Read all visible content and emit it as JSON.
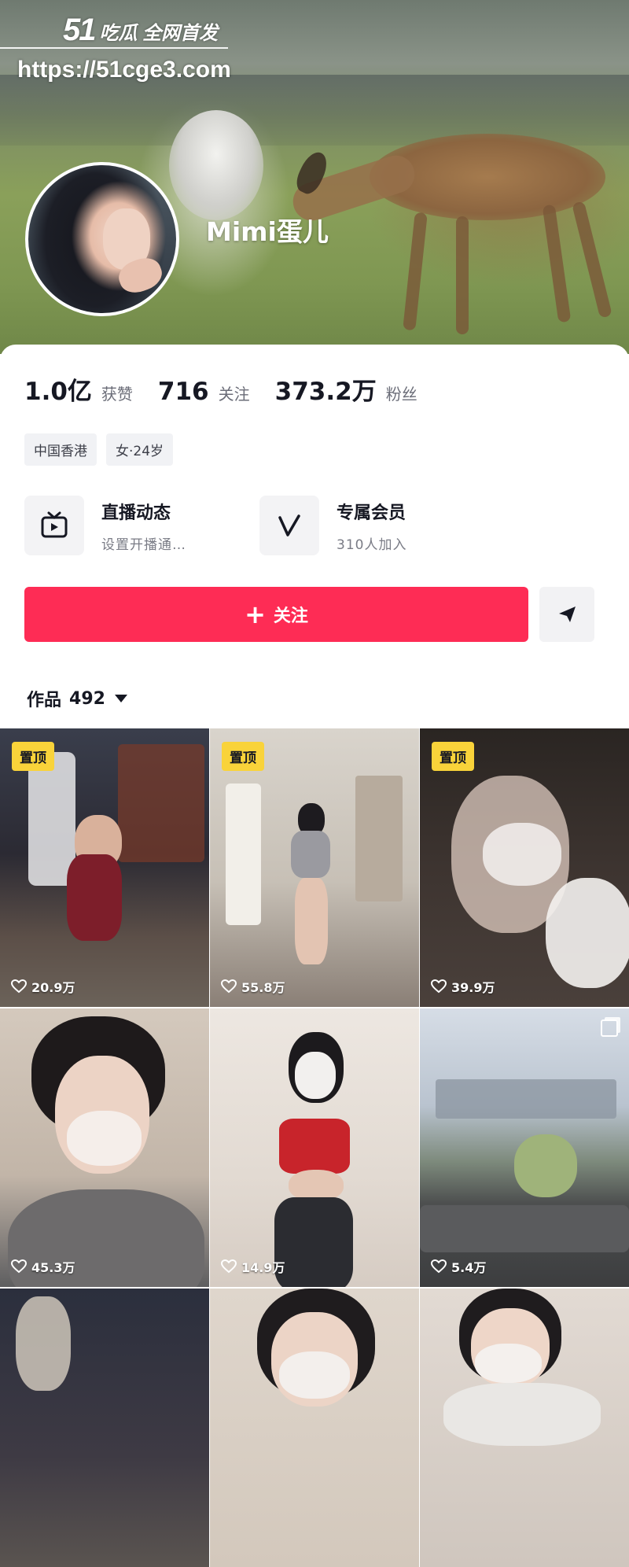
{
  "watermark": {
    "logo_number": "51",
    "logo_text": "吃瓜 全网首发",
    "url": "https://51cge3.com"
  },
  "profile": {
    "username": "Mimi蛋儿"
  },
  "stats": [
    {
      "value": "1.0亿",
      "label": "获赞"
    },
    {
      "value": "716",
      "label": "关注"
    },
    {
      "value": "373.2万",
      "label": "粉丝"
    }
  ],
  "tags": [
    "中国香港",
    "女·24岁"
  ],
  "features": {
    "live": {
      "icon": "tv-icon",
      "title": "直播动态",
      "subtitle": "设置开播通…"
    },
    "membership": {
      "icon": "v-icon",
      "title": "专属会员",
      "subtitle": "310人加入"
    }
  },
  "actions": {
    "follow_label": "关注",
    "share_icon": "send-icon"
  },
  "works": {
    "label": "作品",
    "count": "492"
  },
  "colors": {
    "accent": "#fe2c55",
    "pin": "#f9d33a"
  },
  "videos": [
    {
      "pinned": "置顶",
      "likes": "20.9万"
    },
    {
      "pinned": "置顶",
      "likes": "55.8万"
    },
    {
      "pinned": "置顶",
      "likes": "39.9万"
    },
    {
      "likes": "45.3万"
    },
    {
      "likes": "14.9万"
    },
    {
      "likes": "5.4万"
    },
    {
      "likes": ""
    },
    {
      "likes": ""
    },
    {
      "likes": ""
    }
  ]
}
